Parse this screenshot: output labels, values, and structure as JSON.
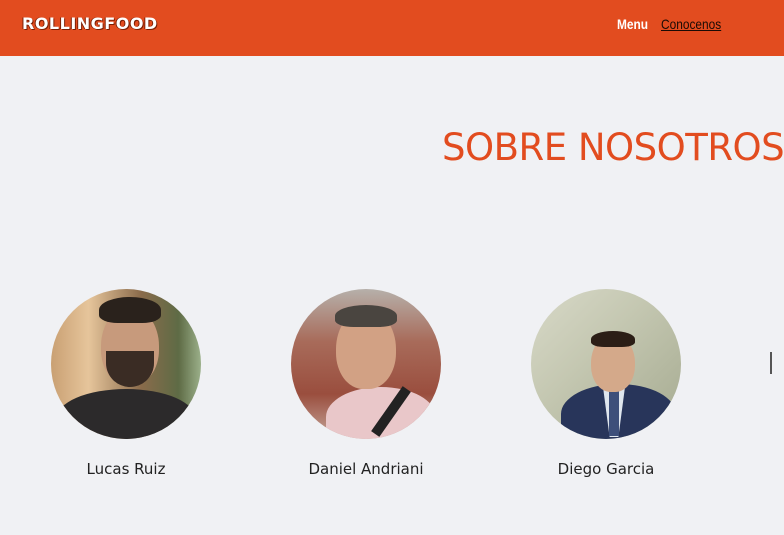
{
  "navbar": {
    "brand": "ROLLINGFOOD",
    "links": [
      {
        "label": "Menu"
      },
      {
        "label": "Conocenos"
      }
    ],
    "color": "#e24c1f"
  },
  "main": {
    "title": "SOBRE NOSOTROS",
    "members": [
      {
        "name": "Lucas Ruiz"
      },
      {
        "name": "Daniel Andriani"
      },
      {
        "name": "Diego Garcia"
      }
    ]
  }
}
